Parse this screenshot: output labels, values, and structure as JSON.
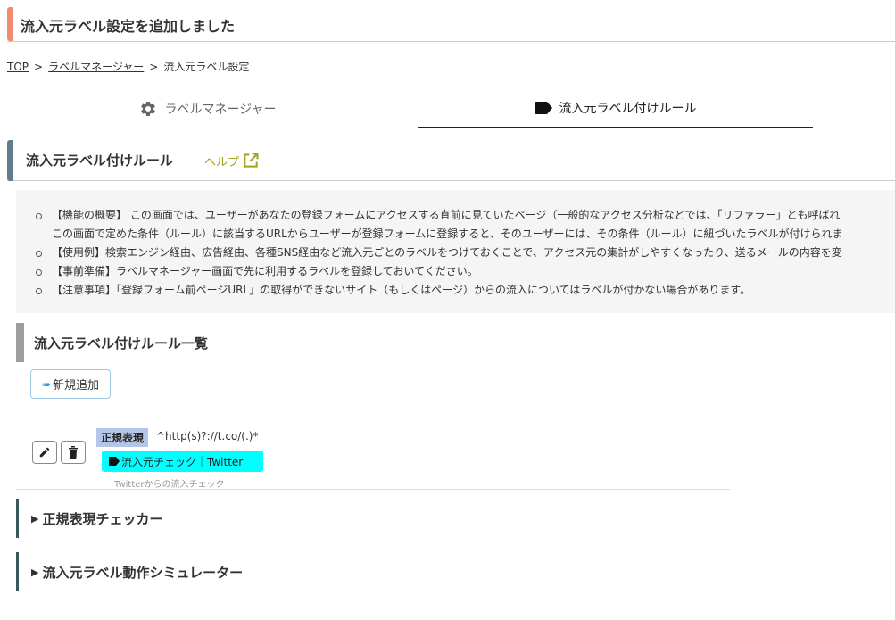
{
  "notice": {
    "text": "流入元ラベル設定を追加しました"
  },
  "breadcrumb": {
    "items": [
      "TOP",
      "ラベルマネージャー",
      "流入元ラベル設定"
    ],
    "separator": ">"
  },
  "tabs": [
    {
      "label": "ラベルマネージャー",
      "icon": "gear-icon",
      "active": false
    },
    {
      "label": "流入元ラベル付けルール",
      "icon": "tag-icon",
      "active": true
    }
  ],
  "section": {
    "title": "流入元ラベル付けルール",
    "help_label": "ヘルプ"
  },
  "info": {
    "lines": [
      "【機能の概要】 この画面では、ユーザーがあなたの登録フォームにアクセスする直前に見ていたページ（一般的なアクセス分析などでは、「リファラー」とも呼ばれ",
      "この画面で定めた条件（ルール）に該当するURLからユーザーが登録フォームに登録すると、そのユーザーには、その条件（ルール）に紐づいたラベルが付けられま",
      "【使用例】検索エンジン経由、広告経由、各種SNS経由など流入元ごとのラベルをつけておくことで、アクセス元の集計がしやすくなったり、送るメールの内容を変",
      "【事前準備】ラベルマネージャー画面で先に利用するラベルを登録しておいてください。",
      "【注意事項】「登録フォーム前ページURL」の取得ができないサイト（もしくはページ）からの流入についてはラベルが付かない場合があります。"
    ]
  },
  "list": {
    "title": "流入元ラベル付けルール一覧",
    "add_button": "新規追加"
  },
  "rules": [
    {
      "type_badge": "正規表現",
      "pattern": "^http(s)?://t.co/(.)*",
      "label": "流入元チェック｜Twitter",
      "label_color": "#00ffff",
      "description": "Twitterからの流入チェック"
    }
  ],
  "collapsibles": {
    "regex_checker": "正規表現チェッカー",
    "simulator": "流入元ラベル動作シミュレーター"
  },
  "colors": {
    "notice_accent": "#f08a70",
    "section_accent": "#607d8b",
    "help": "#a3a31a",
    "tab_active": "#222222"
  }
}
